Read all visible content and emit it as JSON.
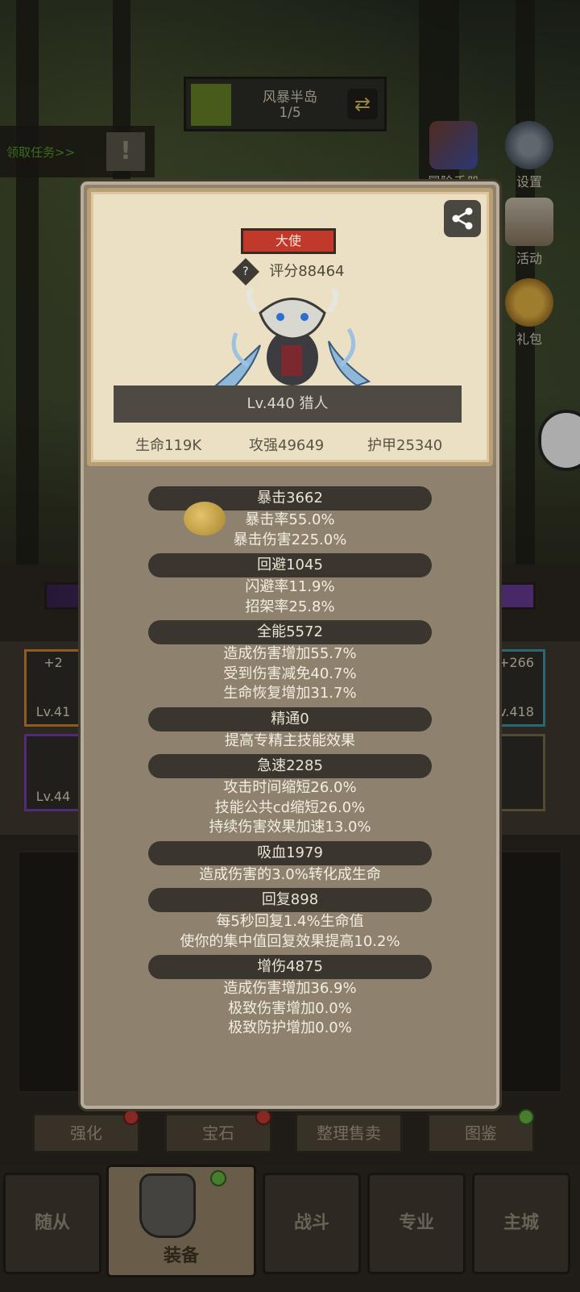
{
  "map": {
    "name": "风暴半岛",
    "progress": "1/5"
  },
  "quest": {
    "label": "领取任务>>",
    "alert": "!"
  },
  "side_buttons": [
    "冒险手册",
    "设置",
    "活动",
    "礼包"
  ],
  "hero": {
    "rank": "大使",
    "score": "评分88464",
    "name_level": "Lv.440 猎人",
    "hp": "生命119K",
    "attack": "攻强49649",
    "armor": "护甲25340"
  },
  "stats": [
    {
      "header": "暴击3662",
      "lines": [
        "暴击率55.0%",
        "暴击伤害225.0%"
      ]
    },
    {
      "header": "回避1045",
      "lines": [
        "闪避率11.9%",
        "招架率25.8%"
      ]
    },
    {
      "header": "全能5572",
      "lines": [
        "造成伤害增加55.7%",
        "受到伤害减免40.7%",
        "生命恢复增加31.7%"
      ]
    },
    {
      "header": "精通0",
      "lines": [
        "提高专精主技能效果"
      ]
    },
    {
      "header": "急速2285",
      "lines": [
        "攻击时间缩短26.0%",
        "技能公共cd缩短26.0%",
        "持续伤害效果加速13.0%"
      ]
    },
    {
      "header": "吸血1979",
      "lines": [
        "造成伤害的3.0%转化成生命"
      ]
    },
    {
      "header": "回复898",
      "lines": [
        "每5秒回复1.4%生命值",
        "使你的集中值回复效果提高10.2%"
      ]
    },
    {
      "header": "增伤4875",
      "lines": [
        "造成伤害增加36.9%",
        "极致伤害增加0.0%",
        "极致防护增加0.0%"
      ]
    }
  ],
  "bg_slots": {
    "left_top": {
      "plus": "+2",
      "level": "Lv.41"
    },
    "left_bottom": {
      "level": "Lv.44"
    },
    "right_top": {
      "plus": "+266",
      "level": "v.418"
    }
  },
  "actions": [
    "强化",
    "宝石",
    "整理售卖",
    "图鉴"
  ],
  "nav": [
    "随从",
    "装备",
    "战斗",
    "专业",
    "主城"
  ],
  "colors": {
    "rank_badge": "#c0392b",
    "panel": "#8e826e",
    "card": "#ece0c4"
  }
}
